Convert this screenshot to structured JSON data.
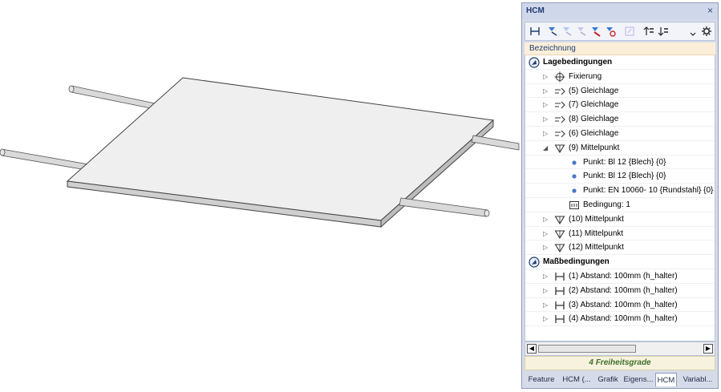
{
  "viewport": {
    "colors": {
      "plate_top": "#ececec",
      "plate_edge": "#c8c8c8",
      "rod": "#d6d6d6",
      "outline": "#444444"
    }
  },
  "panel": {
    "title": "HCM",
    "close_icon": "close-icon",
    "toolbar": {
      "buttons": [
        {
          "icon": "dimension-icon",
          "enabled": true
        },
        {
          "icon": "hcm-filter-icon",
          "enabled": true
        },
        {
          "icon": "hcm-filter-2-icon",
          "enabled": false
        },
        {
          "icon": "hcm-filter-3-icon",
          "enabled": false
        },
        {
          "icon": "hcm-filter-red-icon",
          "enabled": true
        },
        {
          "icon": "hcm-filter-delete-icon",
          "enabled": true
        },
        {
          "icon": "edit-constraint-icon",
          "enabled": false
        },
        {
          "icon": "move-up-icon",
          "enabled": true
        },
        {
          "icon": "move-down-icon",
          "enabled": true
        },
        {
          "icon": "overflow-icon",
          "enabled": true
        },
        {
          "icon": "gear-icon",
          "enabled": true
        }
      ]
    },
    "column_header": "Bezeichnung",
    "tree": [
      {
        "label": "Lagebedingungen",
        "level": 0,
        "bold": true,
        "expander": "group",
        "icon": "group-constraint-icon"
      },
      {
        "label": "Fixierung",
        "level": 1,
        "expander": "collapsed",
        "icon": "crosshair-icon"
      },
      {
        "label": "(5) Gleichlage",
        "level": 1,
        "expander": "collapsed",
        "icon": "coincidence-icon"
      },
      {
        "label": "(7) Gleichlage",
        "level": 1,
        "expander": "collapsed",
        "icon": "coincidence-icon"
      },
      {
        "label": "(8) Gleichlage",
        "level": 1,
        "expander": "collapsed",
        "icon": "coincidence-icon"
      },
      {
        "label": "(6) Gleichlage",
        "level": 1,
        "expander": "collapsed",
        "icon": "coincidence-icon"
      },
      {
        "label": "(9) Mittelpunkt",
        "level": 1,
        "expander": "expanded",
        "icon": "midpoint-icon"
      },
      {
        "label": "Punkt: Bl 12 {Blech} {0}",
        "level": 2,
        "expander": "none",
        "icon": "point-icon"
      },
      {
        "label": "Punkt: Bl 12 {Blech} {0}",
        "level": 2,
        "expander": "none",
        "icon": "point-icon"
      },
      {
        "label": "Punkt: EN 10060- 10 {Rundstahl} {0}",
        "level": 2,
        "expander": "none",
        "icon": "point-icon"
      },
      {
        "label": "Bedingung: 1",
        "level": 2,
        "expander": "none",
        "icon": "condition-icon"
      },
      {
        "label": "(10) Mittelpunkt",
        "level": 1,
        "expander": "collapsed",
        "icon": "midpoint-icon"
      },
      {
        "label": "(11) Mittelpunkt",
        "level": 1,
        "expander": "collapsed",
        "icon": "midpoint-icon"
      },
      {
        "label": "(12) Mittelpunkt",
        "level": 1,
        "expander": "collapsed",
        "icon": "midpoint-icon"
      },
      {
        "label": "Maßbedingungen",
        "level": 0,
        "bold": true,
        "expander": "group",
        "icon": "group-constraint-icon"
      },
      {
        "label": "(1) Abstand: 100mm (h_halter)",
        "level": 1,
        "expander": "collapsed",
        "icon": "distance-icon"
      },
      {
        "label": "(2) Abstand: 100mm (h_halter)",
        "level": 1,
        "expander": "collapsed",
        "icon": "distance-icon"
      },
      {
        "label": "(3) Abstand: 100mm (h_halter)",
        "level": 1,
        "expander": "collapsed",
        "icon": "distance-icon"
      },
      {
        "label": "(4) Abstand: 100mm (h_halter)",
        "level": 1,
        "expander": "collapsed",
        "icon": "distance-icon"
      }
    ],
    "status": "4 Freiheitsgrade",
    "tabs": [
      {
        "label": "Feature",
        "active": false
      },
      {
        "label": "HCM (...",
        "active": false
      },
      {
        "label": "Grafik",
        "active": false
      },
      {
        "label": "Eigens...",
        "active": false
      },
      {
        "label": "HCM",
        "active": true
      },
      {
        "label": "Variabl...",
        "active": false
      }
    ],
    "colors": {
      "status_text": "#3f6f2a",
      "header_bg": "#fbefd9",
      "accent": "#1f3b6f"
    }
  }
}
